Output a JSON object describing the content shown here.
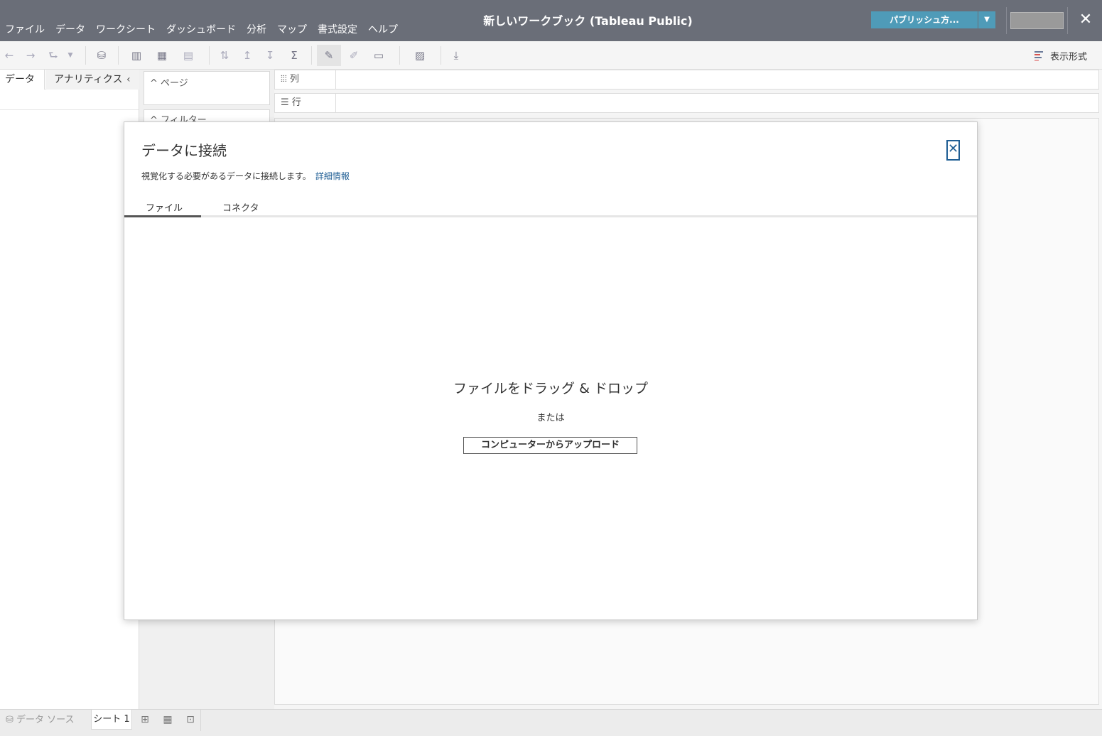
{
  "window": {
    "title": "新しいワークブック (Tableau Public)"
  },
  "menu": {
    "items": [
      "ファイル",
      "データ",
      "ワークシート",
      "ダッシュボード",
      "分析",
      "マップ",
      "書式設定",
      "ヘルプ"
    ]
  },
  "header": {
    "publish_label": "パブリッシュ方...",
    "publish_dropdown_icon": "caret-down-icon",
    "close_icon": "close-icon"
  },
  "toolbar": {
    "show_me_label": "表示形式"
  },
  "left_panel": {
    "tab_data": "データ",
    "tab_analytics": "アナリティクス",
    "collapse_glyph": "‹"
  },
  "cards": {
    "pages_label": "ページ",
    "filters_label": "フィルター"
  },
  "shelves": {
    "columns_label": "列",
    "rows_label": "行"
  },
  "bottom_bar": {
    "data_source_label": "データ ソース",
    "sheet_label": "シート 1"
  },
  "dialog": {
    "title": "データに接続",
    "description": "視覚化する必要があるデータに接続します。",
    "learn_more": "詳細情報",
    "tabs": [
      "ファイル",
      "コネクタ"
    ],
    "active_tab": "ファイル",
    "drop_title": "ファイルをドラッグ & ドロップ",
    "or_text": "または",
    "upload_button": "コンピューターからアップロード"
  },
  "colors": {
    "titlebar": "#6a6e78",
    "publish_button": "#4f9bb8",
    "link": "#1f5e94"
  }
}
